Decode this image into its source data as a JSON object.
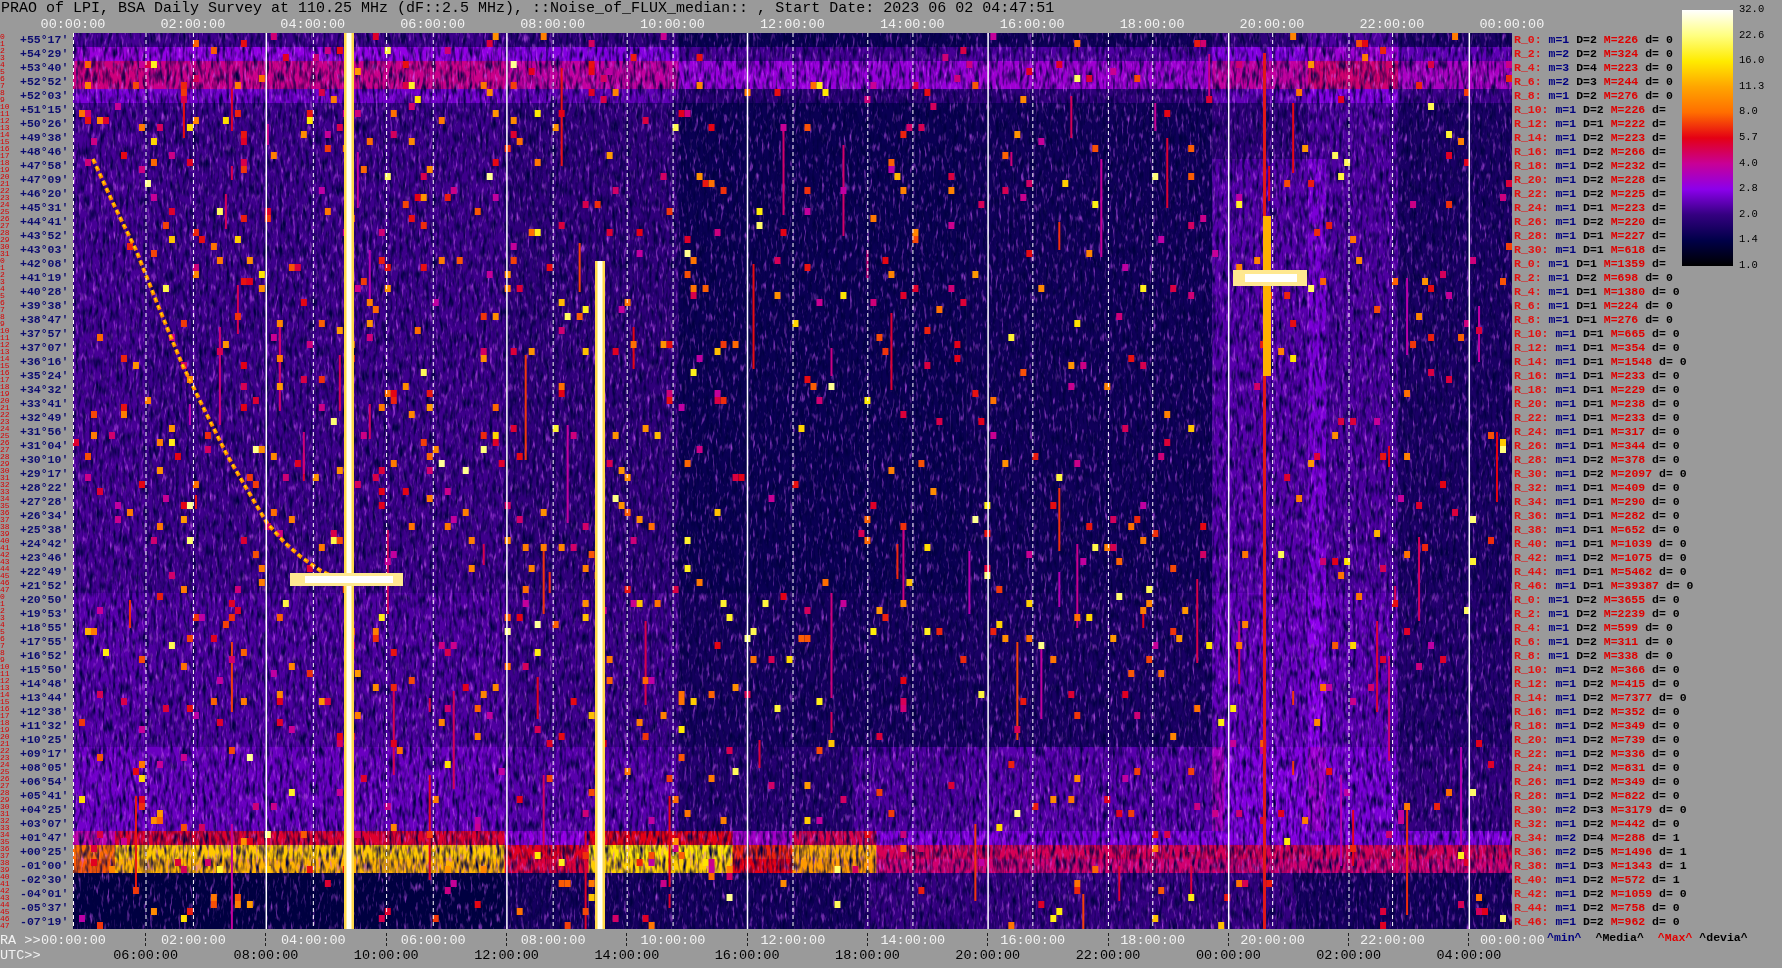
{
  "title": "PRAO of LPI, BSA Daily Survey at 110.25 MHz (dF::2.5 MHz), ::Noise_of_FLUX_median:: , Start Date: 2023 06 02 04:47:51",
  "top_axis": {
    "labels": [
      "00:00:00",
      "02:00:00",
      "04:00:00",
      "06:00:00",
      "08:00:00",
      "10:00:00",
      "12:00:00",
      "14:00:00",
      "16:00:00",
      "18:00:00",
      "20:00:00",
      "22:00:00",
      "00:00:00"
    ]
  },
  "color_scale": {
    "ticks": [
      "32.0",
      "22.6",
      "16.0",
      "11.3",
      "8.0",
      "5.7",
      "4.0",
      "2.8",
      "2.0",
      "1.4",
      "1.0"
    ]
  },
  "declination_rows": [
    {
      "numbers": [
        "0",
        "1"
      ],
      "dec": "+55°17'"
    },
    {
      "numbers": [
        "2",
        "3"
      ],
      "dec": "+54°29'"
    },
    {
      "numbers": [
        "4",
        "5"
      ],
      "dec": "+53°40'"
    },
    {
      "numbers": [
        "6",
        "7"
      ],
      "dec": "+52°52'"
    },
    {
      "numbers": [
        "8",
        "9"
      ],
      "dec": "+52°03'"
    },
    {
      "numbers": [
        "10",
        "11"
      ],
      "dec": "+51°15'"
    },
    {
      "numbers": [
        "12",
        "13"
      ],
      "dec": "+50°26'"
    },
    {
      "numbers": [
        "14",
        "15"
      ],
      "dec": "+49°38'"
    },
    {
      "numbers": [
        "16",
        "17"
      ],
      "dec": "+48°46'"
    },
    {
      "numbers": [
        "18",
        "19"
      ],
      "dec": "+47°58'"
    },
    {
      "numbers": [
        "20",
        "21"
      ],
      "dec": "+47°09'"
    },
    {
      "numbers": [
        "22",
        "23"
      ],
      "dec": "+46°20'"
    },
    {
      "numbers": [
        "24",
        "25"
      ],
      "dec": "+45°31'"
    },
    {
      "numbers": [
        "26",
        "27"
      ],
      "dec": "+44°41'"
    },
    {
      "numbers": [
        "28",
        "29"
      ],
      "dec": "+43°52'"
    },
    {
      "numbers": [
        "30",
        "31"
      ],
      "dec": "+43°03'"
    },
    {
      "numbers": [
        "0",
        "1"
      ],
      "dec": "+42°08'"
    },
    {
      "numbers": [
        "2",
        "3"
      ],
      "dec": "+41°19'"
    },
    {
      "numbers": [
        "4",
        "5"
      ],
      "dec": "+40°28'"
    },
    {
      "numbers": [
        "6",
        "7"
      ],
      "dec": "+39°38'"
    },
    {
      "numbers": [
        "8",
        "9"
      ],
      "dec": "+38°47'"
    },
    {
      "numbers": [
        "10",
        "11"
      ],
      "dec": "+37°57'"
    },
    {
      "numbers": [
        "12",
        "13"
      ],
      "dec": "+37°07'"
    },
    {
      "numbers": [
        "14",
        "15"
      ],
      "dec": "+36°16'"
    },
    {
      "numbers": [
        "16",
        "17"
      ],
      "dec": "+35°24'"
    },
    {
      "numbers": [
        "18",
        "19"
      ],
      "dec": "+34°32'"
    },
    {
      "numbers": [
        "20",
        "21"
      ],
      "dec": "+33°41'"
    },
    {
      "numbers": [
        "22",
        "23"
      ],
      "dec": "+32°49'"
    },
    {
      "numbers": [
        "24",
        "25"
      ],
      "dec": "+31°56'"
    },
    {
      "numbers": [
        "26",
        "27"
      ],
      "dec": "+31°04'"
    },
    {
      "numbers": [
        "28",
        "29"
      ],
      "dec": "+30°10'"
    },
    {
      "numbers": [
        "30",
        "31"
      ],
      "dec": "+29°17'"
    },
    {
      "numbers": [
        "32",
        "33"
      ],
      "dec": "+28°22'"
    },
    {
      "numbers": [
        "34",
        "35"
      ],
      "dec": "+27°28'"
    },
    {
      "numbers": [
        "36",
        "37"
      ],
      "dec": "+26°34'"
    },
    {
      "numbers": [
        "38",
        "39"
      ],
      "dec": "+25°38'"
    },
    {
      "numbers": [
        "40",
        "41"
      ],
      "dec": "+24°42'"
    },
    {
      "numbers": [
        "42",
        "43"
      ],
      "dec": "+23°46'"
    },
    {
      "numbers": [
        "44",
        "45"
      ],
      "dec": "+22°49'"
    },
    {
      "numbers": [
        "46",
        "47"
      ],
      "dec": "+21°52'"
    },
    {
      "numbers": [
        "0",
        "1"
      ],
      "dec": "+20°50'"
    },
    {
      "numbers": [
        "2",
        "3"
      ],
      "dec": "+19°53'"
    },
    {
      "numbers": [
        "4",
        "5"
      ],
      "dec": "+18°55'"
    },
    {
      "numbers": [
        "6",
        "7"
      ],
      "dec": "+17°55'"
    },
    {
      "numbers": [
        "8",
        "9"
      ],
      "dec": "+16°52'"
    },
    {
      "numbers": [
        "10",
        "11"
      ],
      "dec": "+15°50'"
    },
    {
      "numbers": [
        "12",
        "13"
      ],
      "dec": "+14°48'"
    },
    {
      "numbers": [
        "14",
        "15"
      ],
      "dec": "+13°44'"
    },
    {
      "numbers": [
        "16",
        "17"
      ],
      "dec": "+12°38'"
    },
    {
      "numbers": [
        "18",
        "19"
      ],
      "dec": "+11°32'"
    },
    {
      "numbers": [
        "20",
        "21"
      ],
      "dec": "+10°25'"
    },
    {
      "numbers": [
        "22",
        "23"
      ],
      "dec": "+09°17'"
    },
    {
      "numbers": [
        "24",
        "25"
      ],
      "dec": "+08°05'"
    },
    {
      "numbers": [
        "26",
        "27"
      ],
      "dec": "+06°54'"
    },
    {
      "numbers": [
        "28",
        "29"
      ],
      "dec": "+05°41'"
    },
    {
      "numbers": [
        "30",
        "31"
      ],
      "dec": "+04°25'"
    },
    {
      "numbers": [
        "32",
        "33"
      ],
      "dec": "+03°07'"
    },
    {
      "numbers": [
        "34",
        "35"
      ],
      "dec": "+01°47'"
    },
    {
      "numbers": [
        "36",
        "37"
      ],
      "dec": "+00°25'"
    },
    {
      "numbers": [
        "38",
        "39"
      ],
      "dec": "-01°00'"
    },
    {
      "numbers": [
        "40",
        "41"
      ],
      "dec": "-02°30'"
    },
    {
      "numbers": [
        "42",
        "43"
      ],
      "dec": "-04°01'"
    },
    {
      "numbers": [
        "44",
        "45"
      ],
      "dec": "-05°37'"
    },
    {
      "numbers": [
        "46",
        "47"
      ],
      "dec": "-07°19'"
    }
  ],
  "row_stats": [
    {
      "label": "R_0:",
      "min": "m=1",
      "median": "D=2",
      "max": "M=226",
      "dev": "d= 0"
    },
    {
      "label": "R_2:",
      "min": "m=2",
      "median": "D=2",
      "max": "M=324",
      "dev": "d= 0"
    },
    {
      "label": "R_4:",
      "min": "m=3",
      "median": "D=4",
      "max": "M=223",
      "dev": "d= 0"
    },
    {
      "label": "R_6:",
      "min": "m=2",
      "median": "D=3",
      "max": "M=244",
      "dev": "d= 0"
    },
    {
      "label": "R_8:",
      "min": "m=1",
      "median": "D=2",
      "max": "M=276",
      "dev": "d= 0"
    },
    {
      "label": "R_10:",
      "min": "m=1",
      "median": "D=2",
      "max": "M=226",
      "dev": "d="
    },
    {
      "label": "R_12:",
      "min": "m=1",
      "median": "D=1",
      "max": "M=222",
      "dev": "d="
    },
    {
      "label": "R_14:",
      "min": "m=1",
      "median": "D=2",
      "max": "M=223",
      "dev": "d="
    },
    {
      "label": "R_16:",
      "min": "m=1",
      "median": "D=2",
      "max": "M=266",
      "dev": "d="
    },
    {
      "label": "R_18:",
      "min": "m=1",
      "median": "D=2",
      "max": "M=232",
      "dev": "d="
    },
    {
      "label": "R_20:",
      "min": "m=1",
      "median": "D=2",
      "max": "M=228",
      "dev": "d="
    },
    {
      "label": "R_22:",
      "min": "m=1",
      "median": "D=2",
      "max": "M=225",
      "dev": "d="
    },
    {
      "label": "R_24:",
      "min": "m=1",
      "median": "D=1",
      "max": "M=223",
      "dev": "d="
    },
    {
      "label": "R_26:",
      "min": "m=1",
      "median": "D=2",
      "max": "M=220",
      "dev": "d="
    },
    {
      "label": "R_28:",
      "min": "m=1",
      "median": "D=1",
      "max": "M=227",
      "dev": "d="
    },
    {
      "label": "R_30:",
      "min": "m=1",
      "median": "D=1",
      "max": "M=618",
      "dev": "d="
    },
    {
      "label": "R_0:",
      "min": "m=1",
      "median": "D=1",
      "max": "M=1359",
      "dev": "d="
    },
    {
      "label": "R_2:",
      "min": "m=1",
      "median": "D=2",
      "max": "M=698",
      "dev": "d= 0"
    },
    {
      "label": "R_4:",
      "min": "m=1",
      "median": "D=1",
      "max": "M=1380",
      "dev": "d= 0"
    },
    {
      "label": "R_6:",
      "min": "m=1",
      "median": "D=1",
      "max": "M=224",
      "dev": "d= 0"
    },
    {
      "label": "R_8:",
      "min": "m=1",
      "median": "D=1",
      "max": "M=276",
      "dev": "d= 0"
    },
    {
      "label": "R_10:",
      "min": "m=1",
      "median": "D=1",
      "max": "M=665",
      "dev": "d= 0"
    },
    {
      "label": "R_12:",
      "min": "m=1",
      "median": "D=1",
      "max": "M=354",
      "dev": "d= 0"
    },
    {
      "label": "R_14:",
      "min": "m=1",
      "median": "D=1",
      "max": "M=1548",
      "dev": "d= 0"
    },
    {
      "label": "R_16:",
      "min": "m=1",
      "median": "D=1",
      "max": "M=233",
      "dev": "d= 0"
    },
    {
      "label": "R_18:",
      "min": "m=1",
      "median": "D=1",
      "max": "M=229",
      "dev": "d= 0"
    },
    {
      "label": "R_20:",
      "min": "m=1",
      "median": "D=1",
      "max": "M=238",
      "dev": "d= 0"
    },
    {
      "label": "R_22:",
      "min": "m=1",
      "median": "D=1",
      "max": "M=233",
      "dev": "d= 0"
    },
    {
      "label": "R_24:",
      "min": "m=1",
      "median": "D=1",
      "max": "M=317",
      "dev": "d= 0"
    },
    {
      "label": "R_26:",
      "min": "m=1",
      "median": "D=1",
      "max": "M=344",
      "dev": "d= 0"
    },
    {
      "label": "R_28:",
      "min": "m=1",
      "median": "D=2",
      "max": "M=378",
      "dev": "d= 0"
    },
    {
      "label": "R_30:",
      "min": "m=1",
      "median": "D=2",
      "max": "M=2097",
      "dev": "d= 0"
    },
    {
      "label": "R_32:",
      "min": "m=1",
      "median": "D=1",
      "max": "M=409",
      "dev": "d= 0"
    },
    {
      "label": "R_34:",
      "min": "m=1",
      "median": "D=1",
      "max": "M=290",
      "dev": "d= 0"
    },
    {
      "label": "R_36:",
      "min": "m=1",
      "median": "D=1",
      "max": "M=282",
      "dev": "d= 0"
    },
    {
      "label": "R_38:",
      "min": "m=1",
      "median": "D=1",
      "max": "M=652",
      "dev": "d= 0"
    },
    {
      "label": "R_40:",
      "min": "m=1",
      "median": "D=1",
      "max": "M=1039",
      "dev": "d= 0"
    },
    {
      "label": "R_42:",
      "min": "m=1",
      "median": "D=2",
      "max": "M=1075",
      "dev": "d= 0"
    },
    {
      "label": "R_44:",
      "min": "m=1",
      "median": "D=1",
      "max": "M=5462",
      "dev": "d= 0"
    },
    {
      "label": "R_46:",
      "min": "m=1",
      "median": "D=1",
      "max": "M=39387",
      "dev": "d= 0"
    },
    {
      "label": "R_0:",
      "min": "m=1",
      "median": "D=2",
      "max": "M=3655",
      "dev": "d= 0"
    },
    {
      "label": "R_2:",
      "min": "m=1",
      "median": "D=2",
      "max": "M=2239",
      "dev": "d= 0"
    },
    {
      "label": "R_4:",
      "min": "m=1",
      "median": "D=2",
      "max": "M=599",
      "dev": "d= 0"
    },
    {
      "label": "R_6:",
      "min": "m=1",
      "median": "D=2",
      "max": "M=311",
      "dev": "d= 0"
    },
    {
      "label": "R_8:",
      "min": "m=1",
      "median": "D=2",
      "max": "M=338",
      "dev": "d= 0"
    },
    {
      "label": "R_10:",
      "min": "m=1",
      "median": "D=2",
      "max": "M=366",
      "dev": "d= 0"
    },
    {
      "label": "R_12:",
      "min": "m=1",
      "median": "D=2",
      "max": "M=415",
      "dev": "d= 0"
    },
    {
      "label": "R_14:",
      "min": "m=1",
      "median": "D=2",
      "max": "M=7377",
      "dev": "d= 0"
    },
    {
      "label": "R_16:",
      "min": "m=1",
      "median": "D=2",
      "max": "M=352",
      "dev": "d= 0"
    },
    {
      "label": "R_18:",
      "min": "m=1",
      "median": "D=2",
      "max": "M=349",
      "dev": "d= 0"
    },
    {
      "label": "R_20:",
      "min": "m=1",
      "median": "D=2",
      "max": "M=739",
      "dev": "d= 0"
    },
    {
      "label": "R_22:",
      "min": "m=1",
      "median": "D=2",
      "max": "M=336",
      "dev": "d= 0"
    },
    {
      "label": "R_24:",
      "min": "m=1",
      "median": "D=2",
      "max": "M=831",
      "dev": "d= 0"
    },
    {
      "label": "R_26:",
      "min": "m=1",
      "median": "D=2",
      "max": "M=349",
      "dev": "d= 0"
    },
    {
      "label": "R_28:",
      "min": "m=1",
      "median": "D=2",
      "max": "M=822",
      "dev": "d= 0"
    },
    {
      "label": "R_30:",
      "min": "m=2",
      "median": "D=3",
      "max": "M=3179",
      "dev": "d= 0"
    },
    {
      "label": "R_32:",
      "min": "m=1",
      "median": "D=2",
      "max": "M=442",
      "dev": "d= 0"
    },
    {
      "label": "R_34:",
      "min": "m=2",
      "median": "D=4",
      "max": "M=288",
      "dev": "d= 1"
    },
    {
      "label": "R_36:",
      "min": "m=2",
      "median": "D=5",
      "max": "M=1496",
      "dev": "d= 1"
    },
    {
      "label": "R_38:",
      "min": "m=1",
      "median": "D=3",
      "max": "M=1343",
      "dev": "d= 1"
    },
    {
      "label": "R_40:",
      "min": "m=1",
      "median": "D=2",
      "max": "M=572",
      "dev": "d= 1"
    },
    {
      "label": "R_42:",
      "min": "m=1",
      "median": "D=2",
      "max": "M=1059",
      "dev": "d= 0"
    },
    {
      "label": "R_44:",
      "min": "m=1",
      "median": "D=2",
      "max": "M=758",
      "dev": "d= 0"
    },
    {
      "label": "R_46:",
      "min": "m=1",
      "median": "D=2",
      "max": "M=962",
      "dev": "d= 0"
    }
  ],
  "stat_legend": [
    {
      "text": "^min^",
      "color": "#000080"
    },
    {
      "text": "^Media^",
      "color": "#000000"
    },
    {
      "text": "^Max^",
      "color": "#e00000"
    },
    {
      "text": "^devia^",
      "color": "#000000"
    }
  ],
  "bottom_axis": {
    "ra_prefix": "RA >>",
    "ra_labels": [
      "00:00:00",
      "02:00:00",
      "04:00:00",
      "06:00:00",
      "08:00:00",
      "10:00:00",
      "12:00:00",
      "14:00:00",
      "16:00:00",
      "18:00:00",
      "20:00:00",
      "22:00:00",
      "00:00:00"
    ],
    "utc_prefix": "UTC>>",
    "utc_labels": [
      "06:00:00",
      "08:00:00",
      "10:00:00",
      "12:00:00",
      "14:00:00",
      "16:00:00",
      "18:00:00",
      "20:00:00",
      "22:00:00",
      "00:00:00",
      "02:00:00",
      "04:00:00"
    ]
  }
}
